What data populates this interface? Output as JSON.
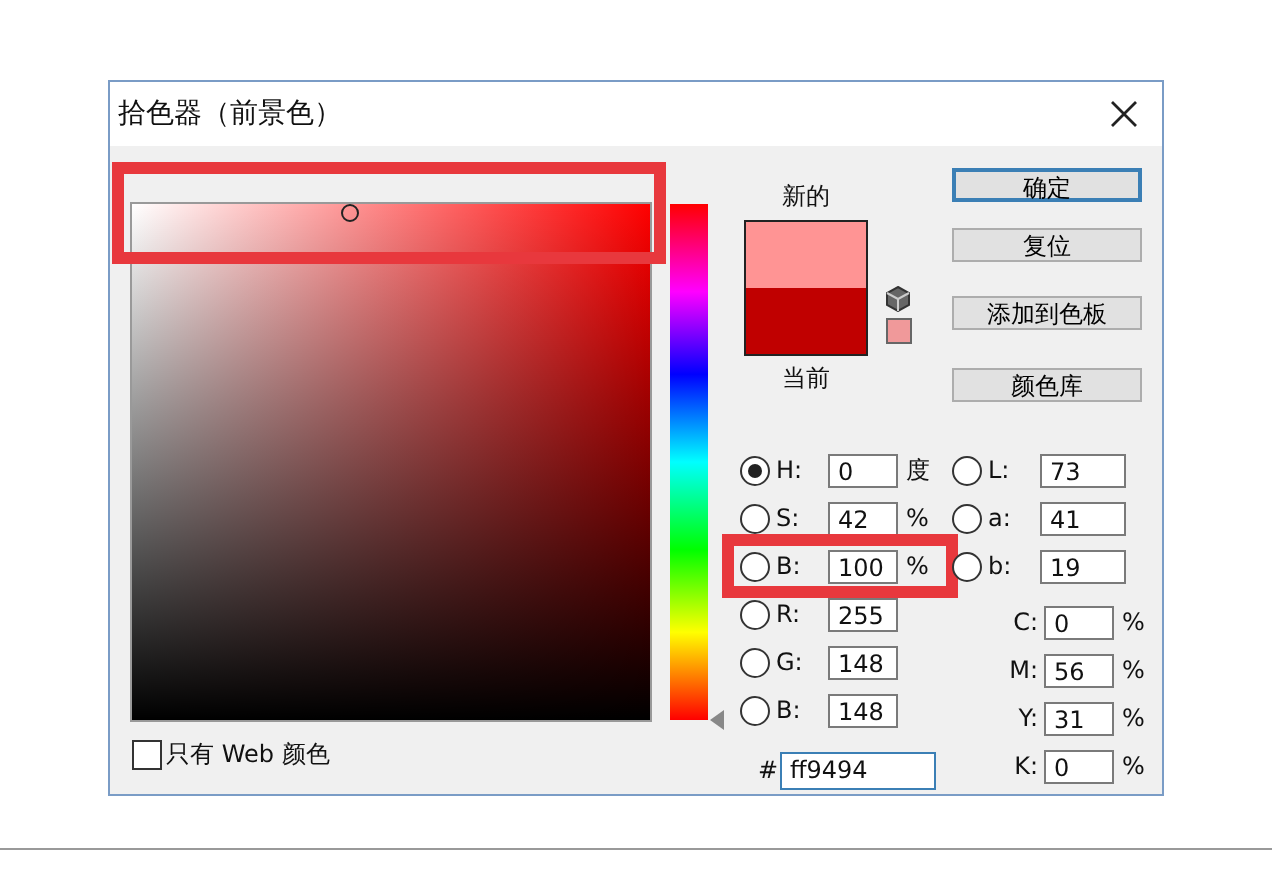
{
  "window": {
    "title": "拾色器（前景色）"
  },
  "color_field": {
    "highlighted": true
  },
  "hue_slider": {
    "level": 0
  },
  "preview": {
    "new_label": "新的",
    "current_label": "当前"
  },
  "buttons": [
    {
      "label": "确定",
      "default": true
    },
    {
      "label": "复位",
      "default": false
    },
    {
      "label": "添加到色板",
      "default": false
    },
    {
      "label": "颜色库",
      "default": false
    }
  ],
  "hsb_rgb": [
    {
      "label": "H:",
      "value": "0",
      "unit": "度",
      "selected": true,
      "highlighted": false
    },
    {
      "label": "S:",
      "value": "42",
      "unit": "%",
      "selected": false,
      "highlighted": false
    },
    {
      "label": "B:",
      "value": "100",
      "unit": "%",
      "selected": false,
      "highlighted": true
    },
    {
      "label": "R:",
      "value": "255",
      "selected": false,
      "highlighted": false
    },
    {
      "label": "G:",
      "value": "148",
      "selected": false,
      "highlighted": false
    },
    {
      "label": "B:",
      "value": "148",
      "selected": false,
      "highlighted": false
    }
  ],
  "lab": [
    {
      "label": "L:",
      "value": "73",
      "selected": false
    },
    {
      "label": "a:",
      "value": "41",
      "selected": false
    },
    {
      "label": "b:",
      "value": "19",
      "selected": false
    }
  ],
  "cmyk": [
    {
      "label": "C:",
      "value": "0",
      "unit": "%"
    },
    {
      "label": "M:",
      "value": "56",
      "unit": "%"
    },
    {
      "label": "Y:",
      "value": "31",
      "unit": "%"
    },
    {
      "label": "K:",
      "value": "0",
      "unit": "%"
    }
  ],
  "hex": {
    "label": "#",
    "value": "ff9494"
  },
  "web_only": {
    "label": "只有 Web 颜色",
    "checked": false
  }
}
